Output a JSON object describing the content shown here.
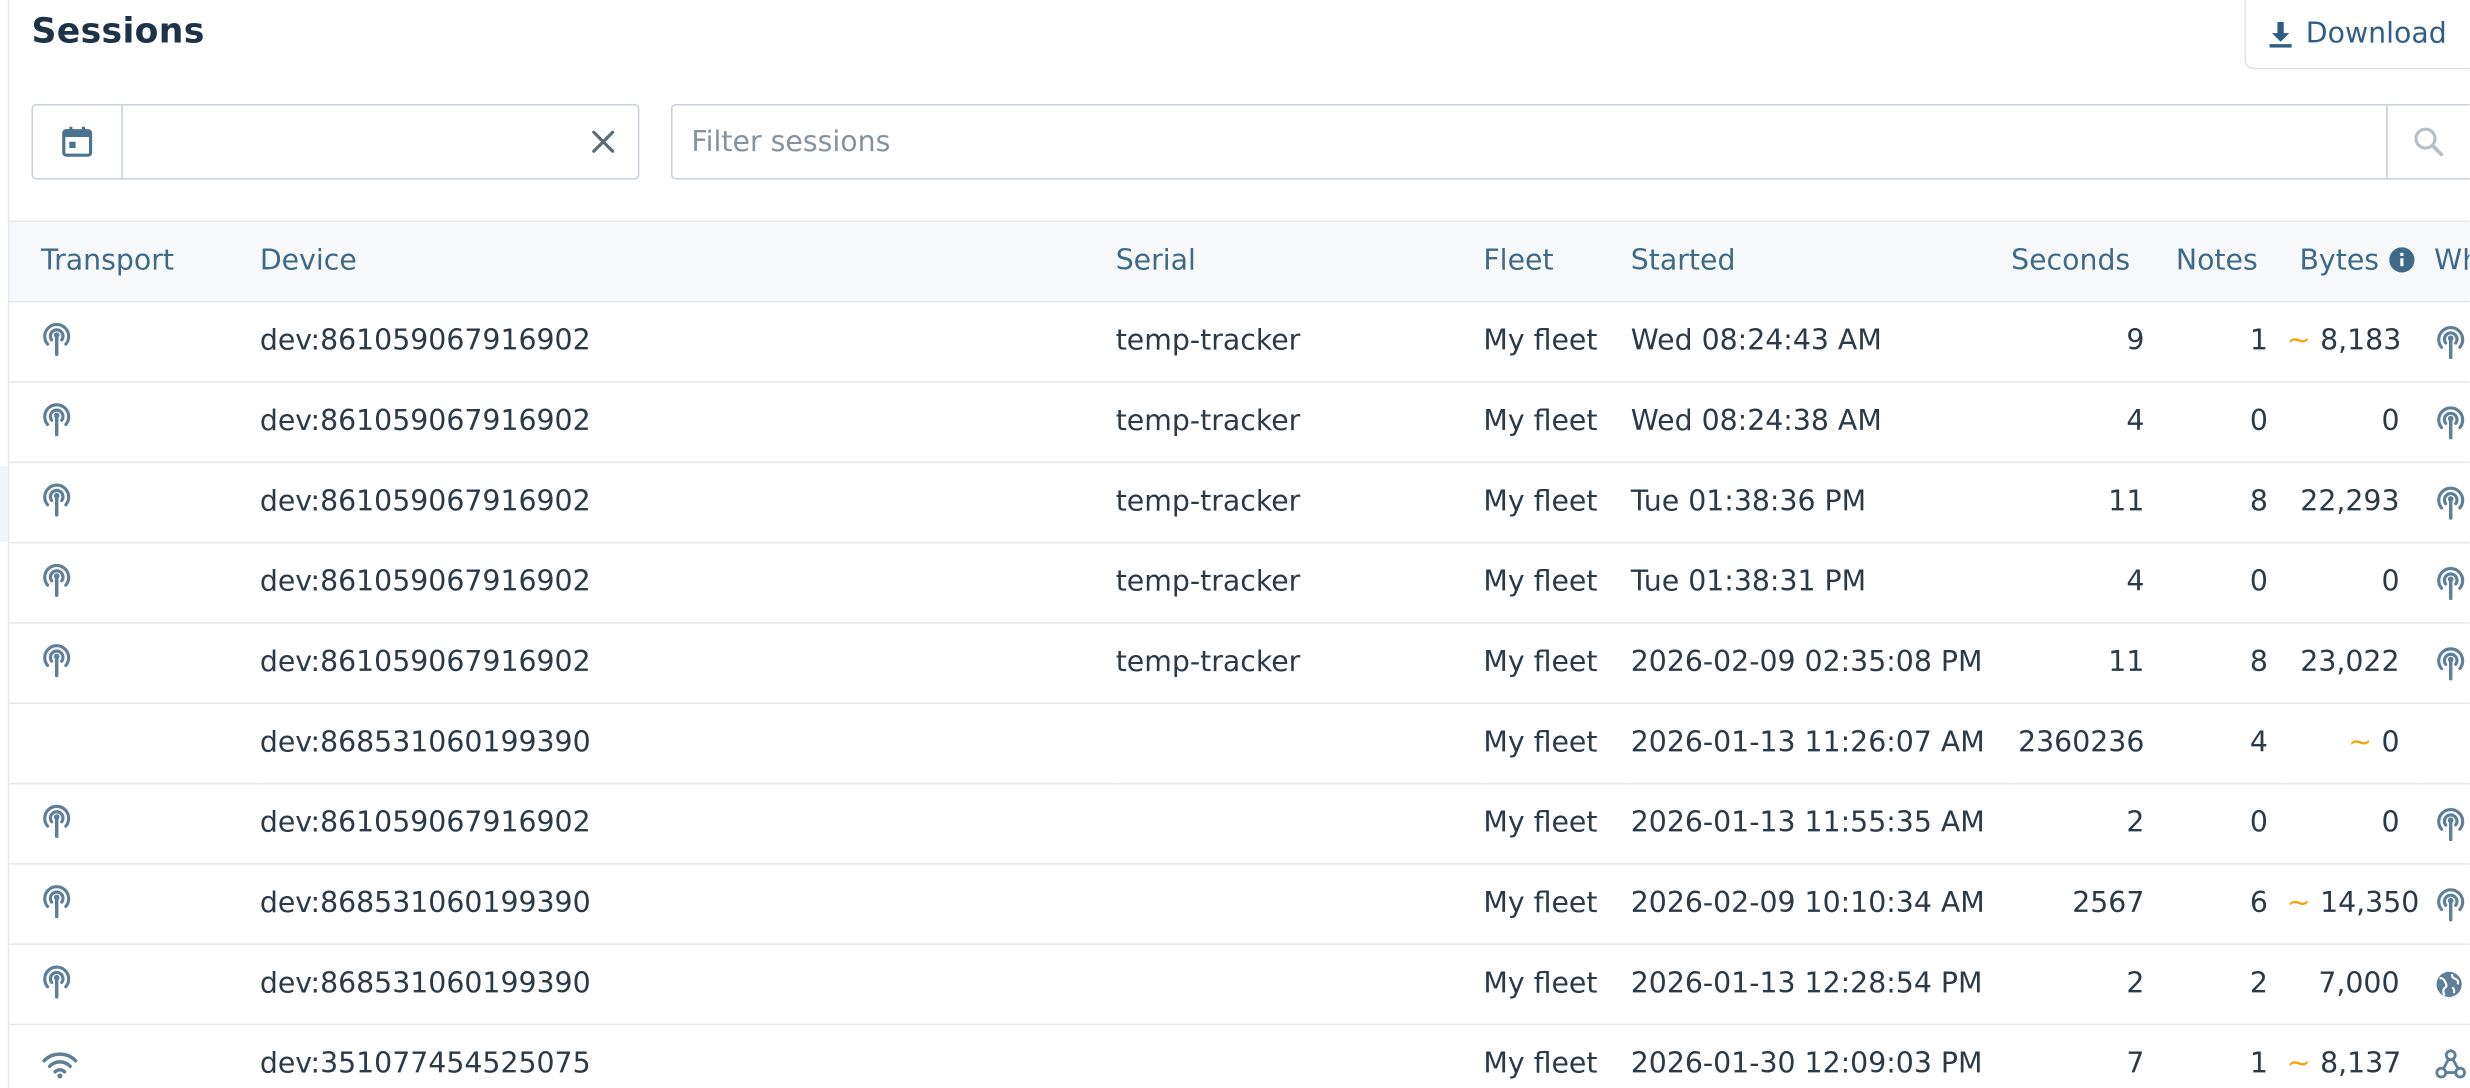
{
  "header": {
    "title": "Sessions",
    "download_label": "Download"
  },
  "filters": {
    "date_value": "",
    "search_placeholder": "Filter sessions"
  },
  "table": {
    "columns": {
      "transport": "Transport",
      "device": "Device",
      "serial": "Serial",
      "fleet": "Fleet",
      "started": "Started",
      "seconds": "Seconds",
      "notes": "Notes",
      "bytes": "Bytes",
      "wh": "Wh"
    },
    "rows": [
      {
        "transport_icon": "cellular-tower-icon",
        "device": "dev:861059067916902",
        "serial": "temp-tracker",
        "fleet": "My fleet",
        "started": "Wed 08:24:43 AM",
        "seconds": "9",
        "notes": "1",
        "bytes_approx": true,
        "bytes": "8,183",
        "wh_icon": "cellular-tower-icon"
      },
      {
        "transport_icon": "cellular-tower-icon",
        "device": "dev:861059067916902",
        "serial": "temp-tracker",
        "fleet": "My fleet",
        "started": "Wed 08:24:38 AM",
        "seconds": "4",
        "notes": "0",
        "bytes_approx": false,
        "bytes": "0",
        "wh_icon": "cellular-tower-icon"
      },
      {
        "transport_icon": "cellular-tower-icon",
        "device": "dev:861059067916902",
        "serial": "temp-tracker",
        "fleet": "My fleet",
        "started": "Tue 01:38:36 PM",
        "seconds": "11",
        "notes": "8",
        "bytes_approx": false,
        "bytes": "22,293",
        "wh_icon": "cellular-tower-icon"
      },
      {
        "transport_icon": "cellular-tower-icon",
        "device": "dev:861059067916902",
        "serial": "temp-tracker",
        "fleet": "My fleet",
        "started": "Tue 01:38:31 PM",
        "seconds": "4",
        "notes": "0",
        "bytes_approx": false,
        "bytes": "0",
        "wh_icon": "cellular-tower-icon"
      },
      {
        "transport_icon": "cellular-tower-icon",
        "device": "dev:861059067916902",
        "serial": "temp-tracker",
        "fleet": "My fleet",
        "started": "2026-02-09 02:35:08 PM",
        "seconds": "11",
        "notes": "8",
        "bytes_approx": false,
        "bytes": "23,022",
        "wh_icon": "cellular-tower-icon"
      },
      {
        "transport_icon": "",
        "device": "dev:868531060199390",
        "serial": "",
        "fleet": "My fleet",
        "started": "2026-01-13 11:26:07 AM",
        "seconds": "2360236",
        "notes": "4",
        "bytes_approx": true,
        "bytes": "0",
        "wh_icon": ""
      },
      {
        "transport_icon": "cellular-tower-icon",
        "device": "dev:861059067916902",
        "serial": "",
        "fleet": "My fleet",
        "started": "2026-01-13 11:55:35 AM",
        "seconds": "2",
        "notes": "0",
        "bytes_approx": false,
        "bytes": "0",
        "wh_icon": "cellular-tower-icon"
      },
      {
        "transport_icon": "cellular-tower-icon",
        "device": "dev:868531060199390",
        "serial": "",
        "fleet": "My fleet",
        "started": "2026-02-09 10:10:34 AM",
        "seconds": "2567",
        "notes": "6",
        "bytes_approx": true,
        "bytes": "14,350",
        "wh_icon": "cellular-tower-icon"
      },
      {
        "transport_icon": "cellular-tower-icon",
        "device": "dev:868531060199390",
        "serial": "",
        "fleet": "My fleet",
        "started": "2026-01-13 12:28:54 PM",
        "seconds": "2",
        "notes": "2",
        "bytes_approx": false,
        "bytes": "7,000",
        "wh_icon": "globe-icon"
      },
      {
        "transport_icon": "wifi-icon",
        "device": "dev:351077454525075",
        "serial": "",
        "fleet": "My fleet",
        "started": "2026-01-30 12:09:03 PM",
        "seconds": "7",
        "notes": "1",
        "bytes_approx": true,
        "bytes": "8,137",
        "wh_icon": "network-hub-icon"
      }
    ]
  },
  "colors": {
    "accent": "#3e6a8a",
    "approx_marker": "#f5a300",
    "icon": "#5d7f99"
  }
}
